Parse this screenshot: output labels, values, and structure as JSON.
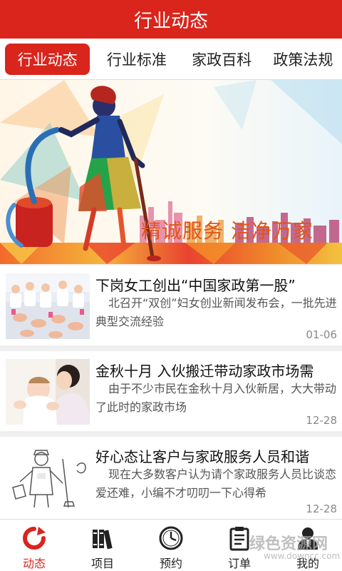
{
  "header": {
    "title": "行业动态"
  },
  "tabs": [
    {
      "label": "行业动态",
      "active": true
    },
    {
      "label": "行业标准"
    },
    {
      "label": "家政百科"
    },
    {
      "label": "政策法规"
    }
  ],
  "banner": {
    "slogan": "精诚服务  洁净万家"
  },
  "news": [
    {
      "title": "下岗女工创出“中国家政第一股”",
      "summary": "北召开“双创”妇女创业新闻发布会，一批先进典型交流经验",
      "date": "01-06"
    },
    {
      "title": "金秋十月 入伙搬迁带动家政市场需",
      "summary": "由于不少市民在金秋十月入伙新居，大大带动了此时的家政市场",
      "date": "12-28"
    },
    {
      "title": "好心态让客户与家政服务人员和谐",
      "summary": "现在大多数客户认为请个家政服务人员比谈恋爱还难，小编不才叨叨一下心得希",
      "date": "12-28"
    }
  ],
  "bottom_nav": [
    {
      "label": "动态",
      "icon": "refresh-icon",
      "active": true
    },
    {
      "label": "项目",
      "icon": "books-icon"
    },
    {
      "label": "预约",
      "icon": "clock-icon"
    },
    {
      "label": "订单",
      "icon": "clipboard-icon"
    },
    {
      "label": "我的",
      "icon": "person-icon"
    }
  ],
  "watermark": {
    "main": "绿色资源网",
    "sub": "www.downcc.com"
  },
  "colors": {
    "accent": "#d9251c",
    "slogan": "#e2541a"
  }
}
